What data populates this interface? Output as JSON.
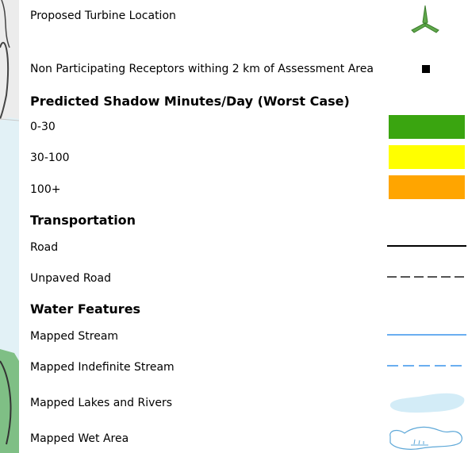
{
  "legend": {
    "items": {
      "turbine": {
        "label": "Proposed Turbine Location",
        "icon": "turbine-icon",
        "color": "#5fa84a"
      },
      "receptors": {
        "label": "Non Participating Receptors withing 2 km of Assessment Area",
        "icon": "square-marker-icon",
        "color": "#000000"
      }
    },
    "shadow": {
      "heading": "Predicted Shadow Minutes/Day (Worst Case)",
      "classes": [
        {
          "label": "0-30",
          "color": "#3aa510"
        },
        {
          "label": "30-100",
          "color": "#ffff00"
        },
        {
          "label": "100+",
          "color": "#ffa500"
        }
      ]
    },
    "transportation": {
      "heading": "Transportation",
      "road": {
        "label": "Road",
        "color": "#000000"
      },
      "unpaved": {
        "label": "Unpaved Road",
        "color": "#555555"
      }
    },
    "water": {
      "heading": "Water Features",
      "stream": {
        "label": "Mapped Stream",
        "color": "#6aaef0"
      },
      "indefinite": {
        "label": "Mapped Indefinite Stream",
        "color": "#6aaef0"
      },
      "lakes": {
        "label": "Mapped Lakes and Rivers",
        "color": "#d3ecf7"
      },
      "wet": {
        "label": "Mapped Wet Area",
        "color": "#5ea8d8"
      }
    }
  }
}
